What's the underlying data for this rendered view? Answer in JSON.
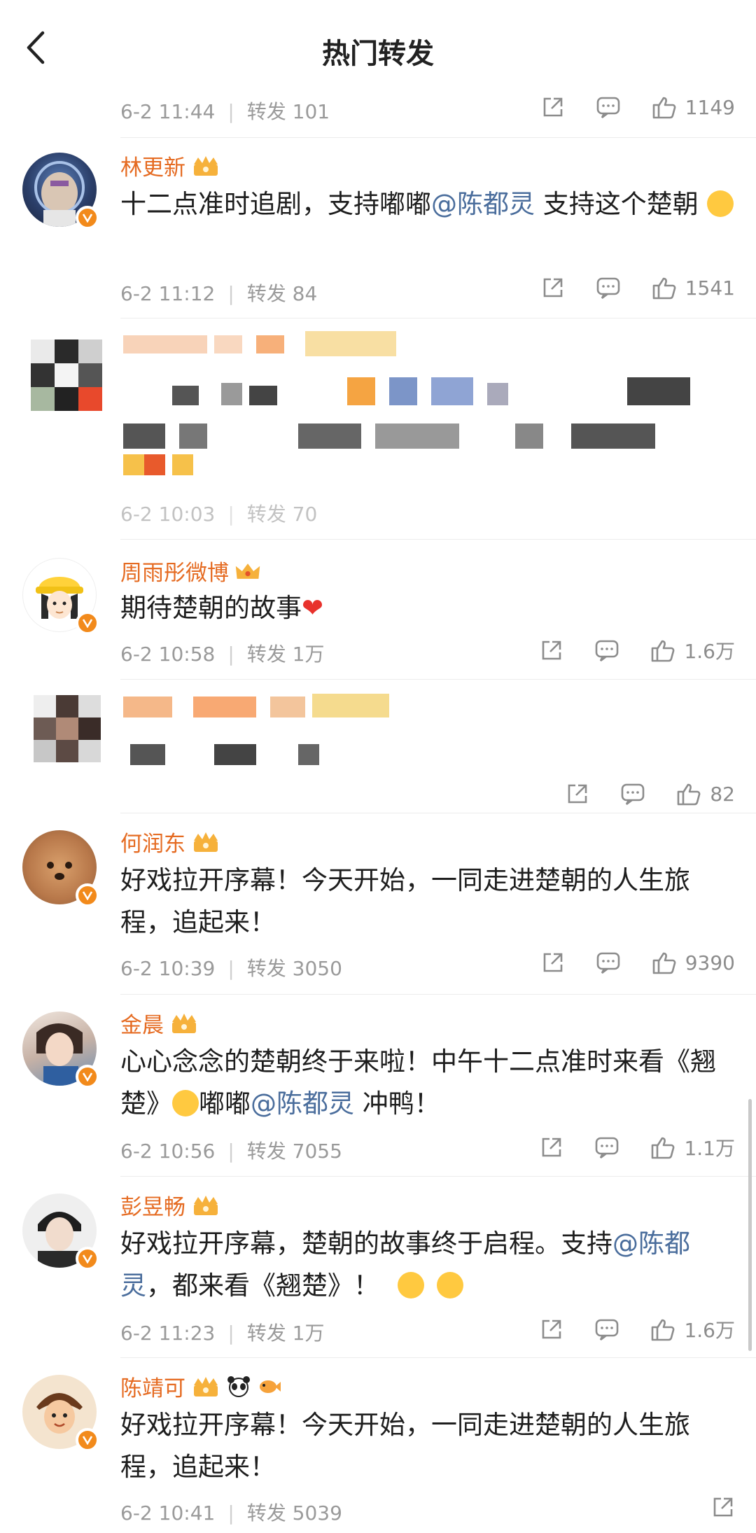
{
  "header": {
    "title": "热门转发"
  },
  "top_partial": {
    "time": "6-2 11:44",
    "repost": "转发 101",
    "likes": "1149"
  },
  "posts": [
    {
      "user": "林更新",
      "content_a": "十二点准时追剧，支持嘟嘟",
      "mention": "@陈都灵",
      "content_b": " 支持这个楚朝",
      "time": "6-2 11:12",
      "repost": "转发 84",
      "likes": "1541"
    },
    {
      "user": "周雨彤微博",
      "content": "期待楚朝的故事",
      "time": "6-2 10:58",
      "repost": "转发 1万",
      "likes": "1.6万"
    },
    {
      "likes": "82"
    },
    {
      "user": "何润东",
      "content": "好戏拉开序幕！今天开始，一同走进楚朝的人生旅程，追起来！",
      "time": "6-2 10:39",
      "repost": "转发 3050",
      "likes": "9390"
    },
    {
      "user": "金晨",
      "content_a": "心心念念的楚朝终于来啦！中午十二点准时来看《翘楚》",
      "content_mid": "嘟嘟",
      "mention": "@陈都灵",
      "content_b": " 冲鸭！",
      "time": "6-2 10:56",
      "repost": "转发 7055",
      "likes": "1.1万"
    },
    {
      "user": "彭昱畅",
      "content_a": "好戏拉开序幕，楚朝的故事终于启程。支持",
      "mention": "@陈都灵",
      "content_b": "，都来看《翘楚》！",
      "time": "6-2 11:23",
      "repost": "转发 1万",
      "likes": "1.6万"
    },
    {
      "user": "陈靖可",
      "content": "好戏拉开序幕！今天开始，一同走进楚朝的人生旅程，追起来！",
      "time": "6-2 10:41",
      "repost": "转发 5039"
    }
  ],
  "blurred_meta": {
    "time": "6-2 10:03",
    "repost": "转发 70"
  },
  "icons": {
    "back": "chevron-left-icon",
    "share": "share-icon",
    "comment": "comment-icon",
    "like": "thumbs-up-icon",
    "crown": "crown-badge-icon",
    "verified": "verified-badge-icon"
  },
  "colors": {
    "username": "#e56b22",
    "mention": "#4a6d9c",
    "meta": "#9a9a9a",
    "badge": "#f28a1b"
  }
}
